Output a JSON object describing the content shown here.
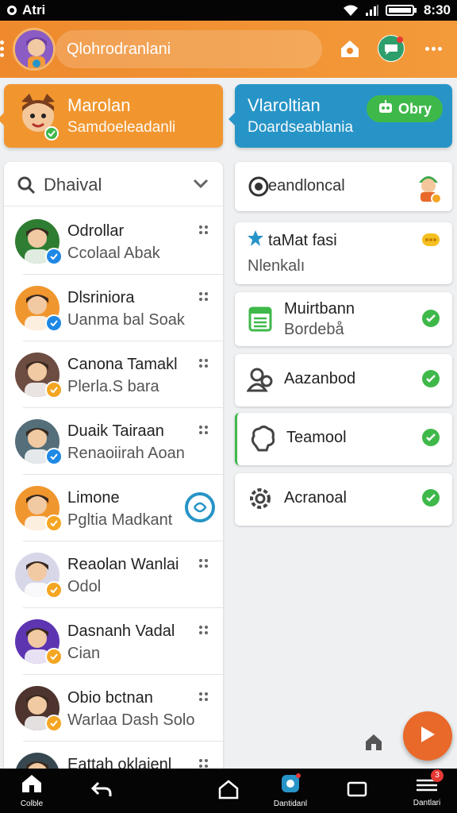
{
  "status_bar": {
    "carrier": "Atri",
    "time": "8:30"
  },
  "app_bar": {
    "search_text": "Qlohrodranlani"
  },
  "top_cards": {
    "left": {
      "title": "Marolan",
      "subtitle": "Samdoeleadanli"
    },
    "right": {
      "title": "Vlaroltian",
      "subtitle": "Doardseablania",
      "button": "Obry"
    }
  },
  "contacts_panel": {
    "header": "Dhaival",
    "contacts": [
      {
        "name": "Odrollar",
        "sub": "Ccolaal Abak",
        "badge_color": "#1e88e5",
        "avatar_bg": "#2e7d32"
      },
      {
        "name": "Dlsriniora",
        "sub": "Uanma bal Soak",
        "badge_color": "#1e88e5",
        "avatar_bg": "#f0962e"
      },
      {
        "name": "Canona Tamakl",
        "sub": "Plerla.S bara",
        "badge_color": "#f4a623",
        "avatar_bg": "#6d4c41"
      },
      {
        "name": "Duaik Tairaan",
        "sub": "Renaoiirah Aoan",
        "badge_color": "#1e88e5",
        "avatar_bg": "#546e7a"
      },
      {
        "name": "Limone",
        "sub": "Pgltia Madkant",
        "badge_color": "#f4a623",
        "avatar_bg": "#f0962e"
      },
      {
        "name": "Reaolan Wanlai",
        "sub": "Odol",
        "badge_color": "#f4a623",
        "avatar_bg": "#d7d7e8"
      },
      {
        "name": "Dasnanh Vadal",
        "sub": "Cian",
        "badge_color": "#f4a623",
        "avatar_bg": "#5e35b1"
      },
      {
        "name": "Obio bctnan",
        "sub": "Warlaa Dash Solo",
        "badge_color": "#f4a623",
        "avatar_bg": "#4e342e"
      },
      {
        "name": "Eattah oklaienl",
        "sub": "",
        "badge_color": "#f4a623",
        "avatar_bg": "#37474f"
      }
    ]
  },
  "right_list": [
    {
      "label": "eandloncal",
      "sub": ""
    },
    {
      "label": "taMat fasi",
      "sub": "Nlenkalı"
    },
    {
      "label": "Muirtbann",
      "sub": "Bordebå"
    },
    {
      "label": "Aazanbod",
      "sub": ""
    },
    {
      "label": "Teamool",
      "sub": ""
    },
    {
      "label": "Acranoal",
      "sub": ""
    }
  ],
  "bottom_nav": {
    "home_label": "Colble",
    "center_label": "Dantidanl",
    "right_label": "Dantlari",
    "notif_count": "3"
  },
  "colors": {
    "accent": "#ee8a2d",
    "blue": "#2794c7",
    "green": "#3fb84a"
  },
  "icons": [
    "search-icon",
    "chevron-down-icon",
    "home-icon",
    "chat-icon",
    "back-icon",
    "play-icon",
    "check-icon",
    "gear-icon",
    "users-icon",
    "list-icon",
    "brain-icon"
  ]
}
